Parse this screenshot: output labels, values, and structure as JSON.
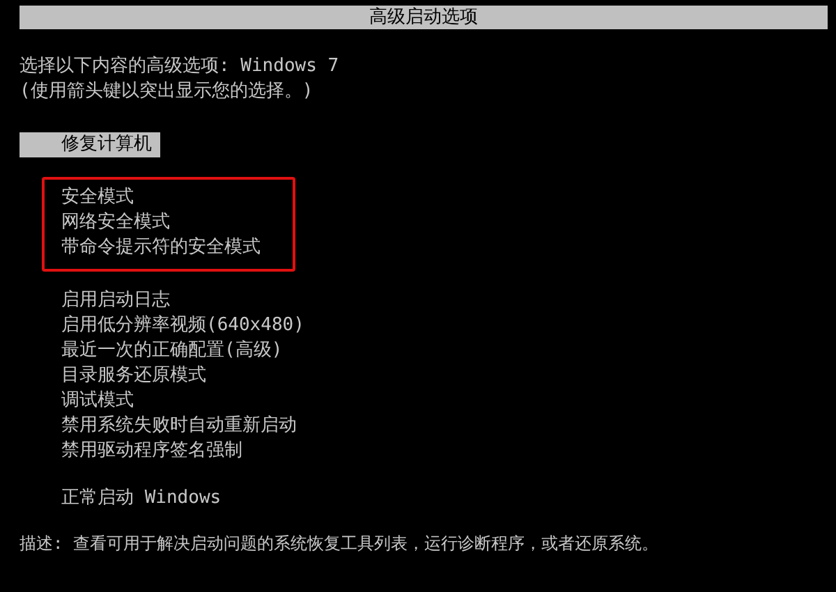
{
  "title": "高级启动选项",
  "prompt": [
    "选择以下内容的高级选项: Windows 7",
    "(使用箭头键以突出显示您的选择。)"
  ],
  "groups": [
    {
      "annotated": false,
      "items": [
        {
          "label": "修复计算机",
          "selected": true
        }
      ]
    },
    {
      "annotated": true,
      "items": [
        {
          "label": "安全模式",
          "selected": false
        },
        {
          "label": "网络安全模式",
          "selected": false
        },
        {
          "label": "带命令提示符的安全模式",
          "selected": false
        }
      ]
    },
    {
      "annotated": false,
      "items": [
        {
          "label": "启用启动日志",
          "selected": false
        },
        {
          "label": "启用低分辨率视频(640x480)",
          "selected": false
        },
        {
          "label": "最近一次的正确配置(高级)",
          "selected": false
        },
        {
          "label": "目录服务还原模式",
          "selected": false
        },
        {
          "label": "调试模式",
          "selected": false
        },
        {
          "label": "禁用系统失败时自动重新启动",
          "selected": false
        },
        {
          "label": "禁用驱动程序签名强制",
          "selected": false
        }
      ]
    },
    {
      "annotated": false,
      "items": [
        {
          "label": "正常启动 Windows",
          "selected": false
        }
      ]
    }
  ],
  "description": "描述: 查看可用于解决启动问题的系统恢复工具列表，运行诊断程序，或者还原系统。"
}
